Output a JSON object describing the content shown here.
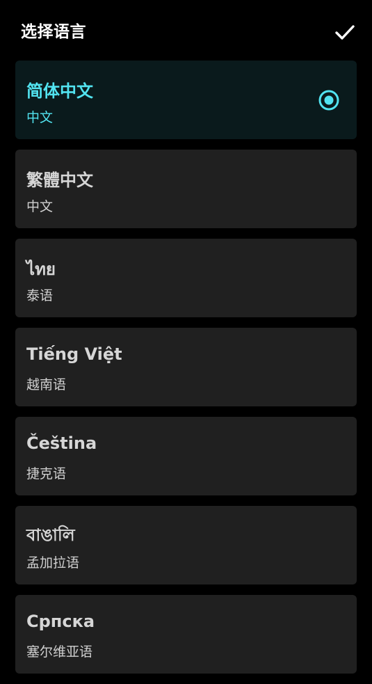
{
  "header": {
    "title": "选择语言",
    "confirm_icon": "check-icon"
  },
  "colors": {
    "background": "#000000",
    "card": "#202020",
    "card_selected": "#0a1a1c",
    "accent": "#52e3f0",
    "text": "#d6d6d6"
  },
  "languages": [
    {
      "name": "简体中文",
      "subtitle": "中文",
      "selected": true
    },
    {
      "name": "繁體中文",
      "subtitle": "中文",
      "selected": false
    },
    {
      "name": "ไทย",
      "subtitle": "泰语",
      "selected": false
    },
    {
      "name": "Tiếng Việt",
      "subtitle": "越南语",
      "selected": false
    },
    {
      "name": "Čeština",
      "subtitle": "捷克语",
      "selected": false
    },
    {
      "name": "বাঙালি",
      "subtitle": "孟加拉语",
      "selected": false
    },
    {
      "name": "Српска",
      "subtitle": "塞尔维亚语",
      "selected": false
    }
  ]
}
